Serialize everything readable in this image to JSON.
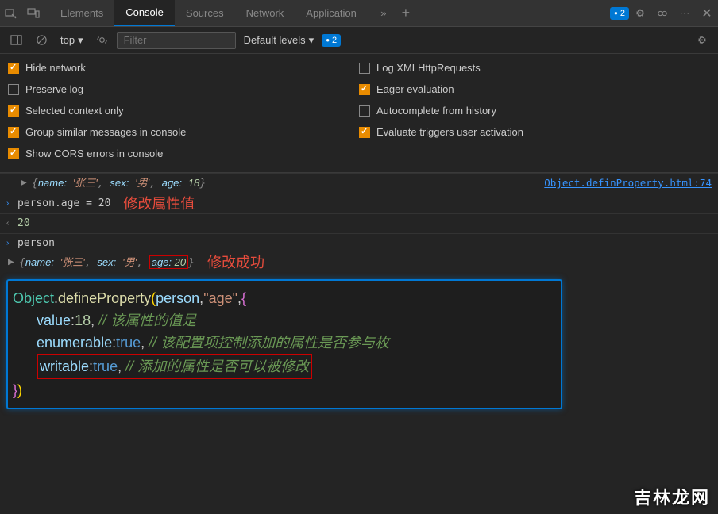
{
  "tabbar": {
    "tabs": [
      "Elements",
      "Console",
      "Sources",
      "Network",
      "Application"
    ],
    "active_index": 1,
    "issue_count": "2"
  },
  "toolbar": {
    "context": "top",
    "filter_placeholder": "Filter",
    "levels_label": "Default levels",
    "issue_count": "2"
  },
  "settings": {
    "left": [
      {
        "label": "Hide network",
        "checked": true
      },
      {
        "label": "Preserve log",
        "checked": false
      },
      {
        "label": "Selected context only",
        "checked": true
      },
      {
        "label": "Group similar messages in console",
        "checked": true
      },
      {
        "label": "Show CORS errors in console",
        "checked": true
      }
    ],
    "right": [
      {
        "label": "Log XMLHttpRequests",
        "checked": false
      },
      {
        "label": "Eager evaluation",
        "checked": true
      },
      {
        "label": "Autocomplete from history",
        "checked": false
      },
      {
        "label": "Evaluate triggers user activation",
        "checked": true
      }
    ]
  },
  "console": {
    "obj_preview1_name": "name:",
    "obj_preview1_name_v": "'张三'",
    "obj_preview1_sex": "sex:",
    "obj_preview1_sex_v": "'男'",
    "obj_preview1_age": "age:",
    "obj_preview1_age_v": "18",
    "src_link": "Object.definProperty.html:74",
    "input1": "person.age = 20",
    "annot1": "修改属性值",
    "output1": "20",
    "input2": "person",
    "obj2_name": "name:",
    "obj2_name_v": "'张三'",
    "obj2_sex": "sex:",
    "obj2_sex_v": "'男'",
    "obj2_age": "age:",
    "obj2_age_v": "20",
    "annot2": "修改成功"
  },
  "code": {
    "l1_obj": "Object",
    "l1_dot": ".",
    "l1_fn": "defineProperty",
    "l1_op": "(",
    "l1_var": "person",
    "l1_c": ",",
    "l1_str": "\"age\"",
    "l1_c2": ",",
    "l1_br": "{",
    "l2_indent": "      ",
    "l2_k": "value",
    "l2_col": ":",
    "l2_v": "18",
    "l2_c": ", ",
    "l2_cm": "// 该属性的值是",
    "l3_indent": "      ",
    "l3_k": "enumerable",
    "l3_col": ":",
    "l3_v": "true",
    "l3_c": ", ",
    "l3_cm": "// 该配置项控制添加的属性是否参与枚",
    "l4_indent": "      ",
    "l4_k": "writable",
    "l4_col": ":",
    "l4_v": "true",
    "l4_c": ", ",
    "l4_cm": "// 添加的属性是否可以被修改",
    "l5_br": "}",
    "l5_cp": ")"
  },
  "watermark": "吉林龙网"
}
